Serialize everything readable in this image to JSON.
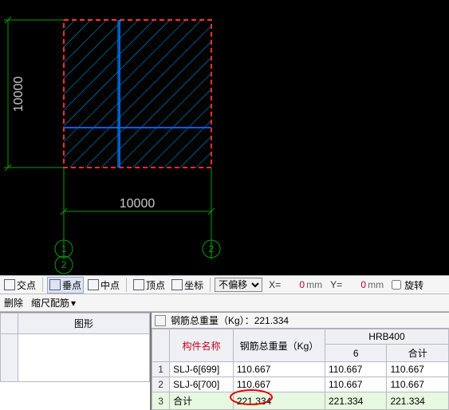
{
  "drawing": {
    "dim_v": "10000",
    "dim_h": "10000",
    "grid_bubbles": [
      "1",
      "2",
      "2"
    ]
  },
  "snapbar": {
    "jiaodian": "交点",
    "chuidian": "垂点",
    "zhongdian": "中点",
    "dingdian": "顶点",
    "zuobiao": "坐标",
    "offset_combo": "不偏移",
    "x_label": "X=",
    "x_val": "0",
    "y_label": "Y=",
    "y_val": "0",
    "unit": "mm",
    "rotate": "旋转"
  },
  "secbar": {
    "delete": "删除",
    "scale": "缩尺配筋"
  },
  "leftpanel": {
    "col_shape": "图形"
  },
  "rightpanel": {
    "total_label": "钢筋总重量（Kg）：",
    "total_value": "221.334",
    "cols": {
      "name": "构件名称",
      "total": "钢筋总重量（Kg）",
      "group": "HRB400",
      "sub1": "6",
      "sub2": "合计"
    },
    "rows": [
      {
        "n": "1",
        "name": "SLJ-6[699]",
        "total": "110.667",
        "c6": "110.667",
        "sum": "110.667"
      },
      {
        "n": "2",
        "name": "SLJ-6[700]",
        "total": "110.667",
        "c6": "110.667",
        "sum": "110.667"
      },
      {
        "n": "3",
        "name": "合计",
        "total": "221.334",
        "c6": "221.334",
        "sum": "221.334"
      }
    ]
  }
}
